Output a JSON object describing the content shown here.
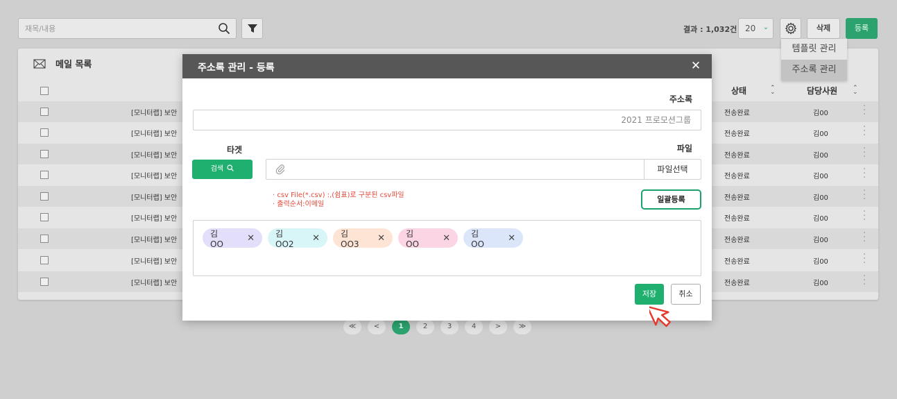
{
  "toolbar": {
    "search_placeholder": "재목/내용",
    "result_count": "결과 : 1,032건",
    "page_size": "20",
    "delete_label": "삭제",
    "register_label": "등록"
  },
  "settings_menu": {
    "items": [
      {
        "label": "템플릿 관리"
      },
      {
        "label": "주소록 관리"
      }
    ]
  },
  "list": {
    "title": "메일 목록",
    "columns": {
      "status": "상태",
      "owner": "담당사원"
    },
    "rows": [
      {
        "subject": "[모니터랩] 보안",
        "status": "전송완료",
        "owner": "김00"
      },
      {
        "subject": "[모니터랩] 보안",
        "status": "전송완료",
        "owner": "김00"
      },
      {
        "subject": "[모니터랩] 보안",
        "status": "전송완료",
        "owner": "김00"
      },
      {
        "subject": "[모니터랩] 보안",
        "status": "전송완료",
        "owner": "김00"
      },
      {
        "subject": "[모니터랩] 보안",
        "status": "전송완료",
        "owner": "김00"
      },
      {
        "subject": "[모니터랩] 보안",
        "status": "전송완료",
        "owner": "김00"
      },
      {
        "subject": "[모니터랩] 보안",
        "status": "전송완료",
        "owner": "김00"
      },
      {
        "subject": "[모니터랩] 보안",
        "status": "전송완료",
        "owner": "김00"
      },
      {
        "subject": "[모니터랩] 보안",
        "status": "전송완료",
        "owner": "김00"
      }
    ]
  },
  "pagination": {
    "first": "≪",
    "prev": "<",
    "pages": [
      "1",
      "2",
      "3",
      "4"
    ],
    "next": ">",
    "last": "≫",
    "current": "1"
  },
  "modal": {
    "title": "주소록 관리 - 등록",
    "addressbook_label": "주소록",
    "addressbook_value": "2021 프로모션그룹",
    "target_label": "타겟",
    "search_button": "검색",
    "file_label": "파일",
    "file_select_button": "파일선택",
    "hint_line1": "· csv File(*.csv) :,(쉼표)로 구분된 csv파일",
    "hint_line2": "· 출력순서:이메일",
    "bulk_register_button": "일괄등록",
    "tags": [
      {
        "label": "김OO",
        "color": "#e3defa"
      },
      {
        "label": "김OO2",
        "color": "#d8f5f8"
      },
      {
        "label": "김OO3",
        "color": "#fde4d5"
      },
      {
        "label": "김OO",
        "color": "#fcd5e4"
      },
      {
        "label": "김OO",
        "color": "#dce6fb"
      }
    ],
    "save_button": "저장",
    "cancel_button": "취소"
  },
  "colors": {
    "accent_green": "#1fb06f",
    "modal_header": "#575757",
    "hint_red": "#e24a3a"
  }
}
